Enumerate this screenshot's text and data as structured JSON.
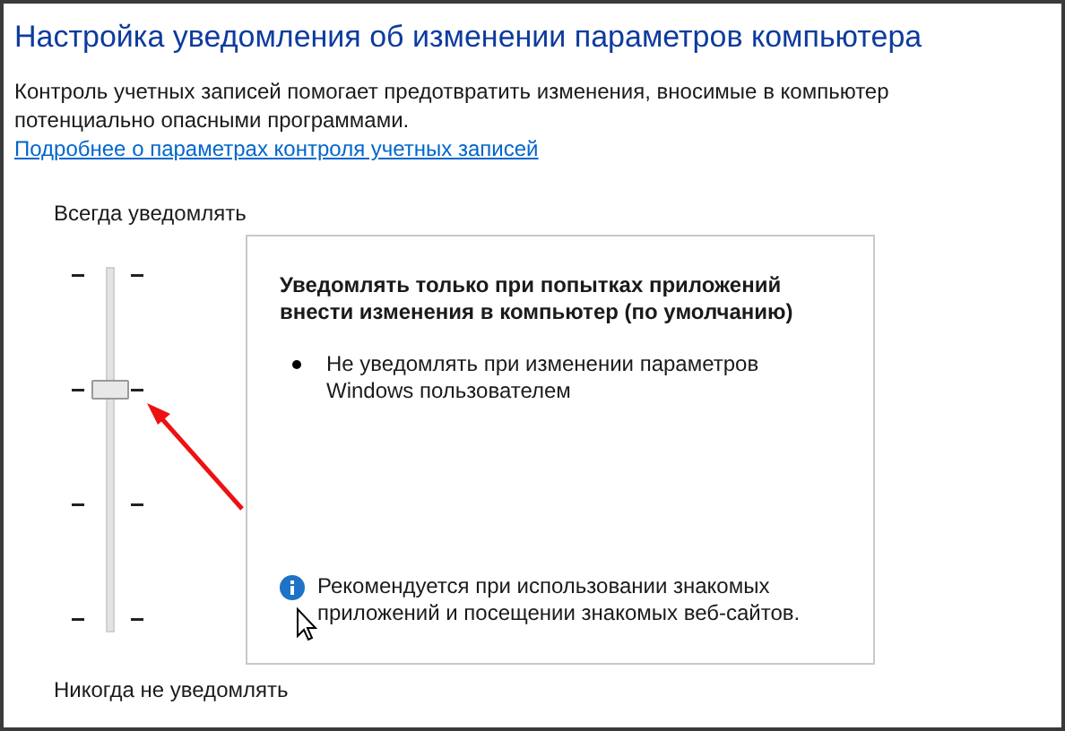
{
  "title": "Настройка уведомления об изменении параметров компьютера",
  "description": "Контроль учетных записей помогает предотвратить изменения, вносимые в компьютер потенциально опасными программами.",
  "link": "Подробнее о параметрах контроля учетных записей",
  "slider": {
    "top_label": "Всегда уведомлять",
    "bottom_label": "Никогда не уведомлять",
    "level": 0.667
  },
  "panel": {
    "heading": "Уведомлять только при попытках приложений внести изменения в компьютер (по умолчанию)",
    "bullets": [
      "Не уведомлять при изменении параметров Windows пользователем"
    ],
    "note": "Рекомендуется при использовании знакомых приложений и посещении знакомых веб-сайтов."
  }
}
